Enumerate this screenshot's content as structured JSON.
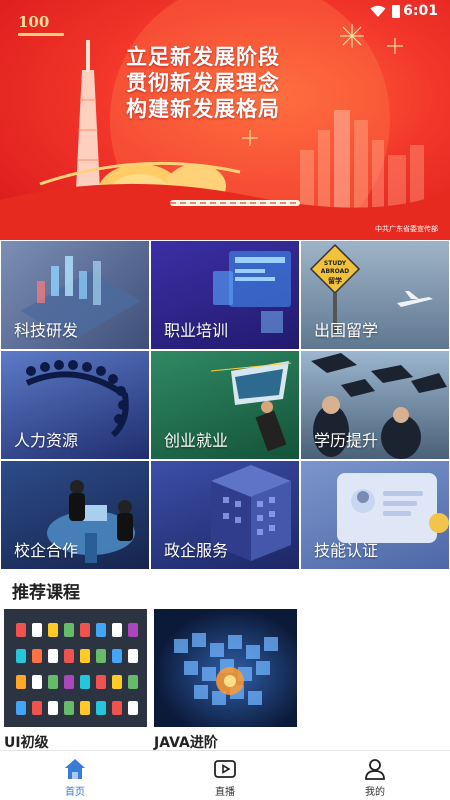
{
  "status_bar": {
    "time": "6:01"
  },
  "banner": {
    "logo_number": "100",
    "slogan_lines": [
      "立足新发展阶段",
      "贯彻新发展理念",
      "构建新发展格局"
    ],
    "publisher": "中共广东省委宣传部"
  },
  "categories": [
    {
      "label": "科技研发",
      "icon": "tech-rd-icon"
    },
    {
      "label": "职业培训",
      "icon": "vocational-training-icon"
    },
    {
      "label": "出国留学",
      "icon": "study-abroad-icon"
    },
    {
      "label": "人力资源",
      "icon": "human-resources-icon"
    },
    {
      "label": "创业就业",
      "icon": "entrepreneurship-icon"
    },
    {
      "label": "学历提升",
      "icon": "education-upgrade-icon"
    },
    {
      "label": "校企合作",
      "icon": "school-enterprise-icon"
    },
    {
      "label": "政企服务",
      "icon": "government-service-icon"
    },
    {
      "label": "技能认证",
      "icon": "skill-certification-icon"
    }
  ],
  "study_abroad_sign": [
    "STUDY",
    "ABROAD",
    "留学"
  ],
  "recommended": {
    "title": "推荐课程",
    "courses": [
      {
        "name": "UI初级"
      },
      {
        "name": "JAVA进阶"
      }
    ]
  },
  "tabbar": {
    "tabs": [
      {
        "label": "首页",
        "icon": "home-icon",
        "active": true
      },
      {
        "label": "直播",
        "icon": "live-icon",
        "active": false
      },
      {
        "label": "我的",
        "icon": "profile-icon",
        "active": false
      }
    ],
    "active_color": "#3a7bd5"
  }
}
